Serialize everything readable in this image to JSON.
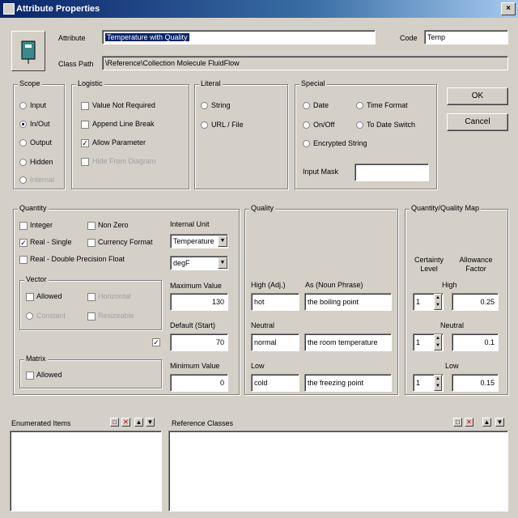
{
  "window": {
    "title": "Attribute Properties",
    "close": "×"
  },
  "header": {
    "attribute_label": "Attribute",
    "attribute_value": "Temperature with Quality",
    "code_label": "Code",
    "code_value": "Temp",
    "class_path_label": "Class Path",
    "class_path_value": "\\Reference\\Collection Molecule FluidFlow"
  },
  "scope": {
    "label": "Scope",
    "options": [
      "Input",
      "In/Out",
      "Output",
      "Hidden",
      "Internal"
    ],
    "selected": "In/Out"
  },
  "logistic": {
    "label": "Logistic",
    "options": [
      "Value Not Required",
      "Append Line Break",
      "Allow Parameter",
      "Hide From Diagram"
    ],
    "checked": [
      "Allow Parameter"
    ]
  },
  "literal": {
    "label": "Literal",
    "options": [
      "String",
      "URL / File"
    ]
  },
  "special": {
    "label": "Special",
    "options": [
      "Date",
      "Time Format",
      "On/Off",
      "To Date Switch",
      "Encrypted String"
    ],
    "input_mask_label": "Input Mask",
    "input_mask_value": ""
  },
  "buttons": {
    "ok": "OK",
    "cancel": "Cancel"
  },
  "quantity": {
    "label": "Quantity",
    "options": [
      "Integer",
      "Non Zero",
      "Real - Single",
      "Currency Format",
      "Real - Double Precision Float"
    ],
    "checked": [
      "Real - Single"
    ],
    "internal_unit_label": "Internal Unit",
    "unit_type": "Temperature",
    "unit": "degF",
    "max_label": "Maximum Value",
    "max_value": "130",
    "default_label": "Default (Start)",
    "default_value": "70",
    "min_label": "Minimum Value",
    "min_value": "0",
    "vector": {
      "label": "Vector",
      "options": [
        "Allowed",
        "Constant",
        "Horizontal",
        "Resizeable"
      ]
    },
    "matrix": {
      "label": "Matrix",
      "options": [
        "Allowed"
      ]
    }
  },
  "quality": {
    "label": "Quality",
    "high_label": "High (Adj.)",
    "as_label": "As (Noun Phrase)",
    "high_value": "hot",
    "high_phrase": "the boiling point",
    "neutral_label": "Neutral",
    "neutral_value": "normal",
    "neutral_phrase": "the room temperature",
    "low_label": "Low",
    "low_value": "cold",
    "low_phrase": "the freezing point"
  },
  "map": {
    "label": "Quantity/Quality Map",
    "certainty_label": "Certainty Level",
    "allowance_label": "Allowance Factor",
    "high_label": "High",
    "high_level": "1",
    "high_factor": "0.25",
    "neutral_label": "Neutral",
    "neutral_level": "1",
    "neutral_factor": "0.1",
    "low_label": "Low",
    "low_level": "1",
    "low_factor": "0.15"
  },
  "enumerated": {
    "label": "Enumerated Items"
  },
  "reference": {
    "label": "Reference Classes"
  }
}
